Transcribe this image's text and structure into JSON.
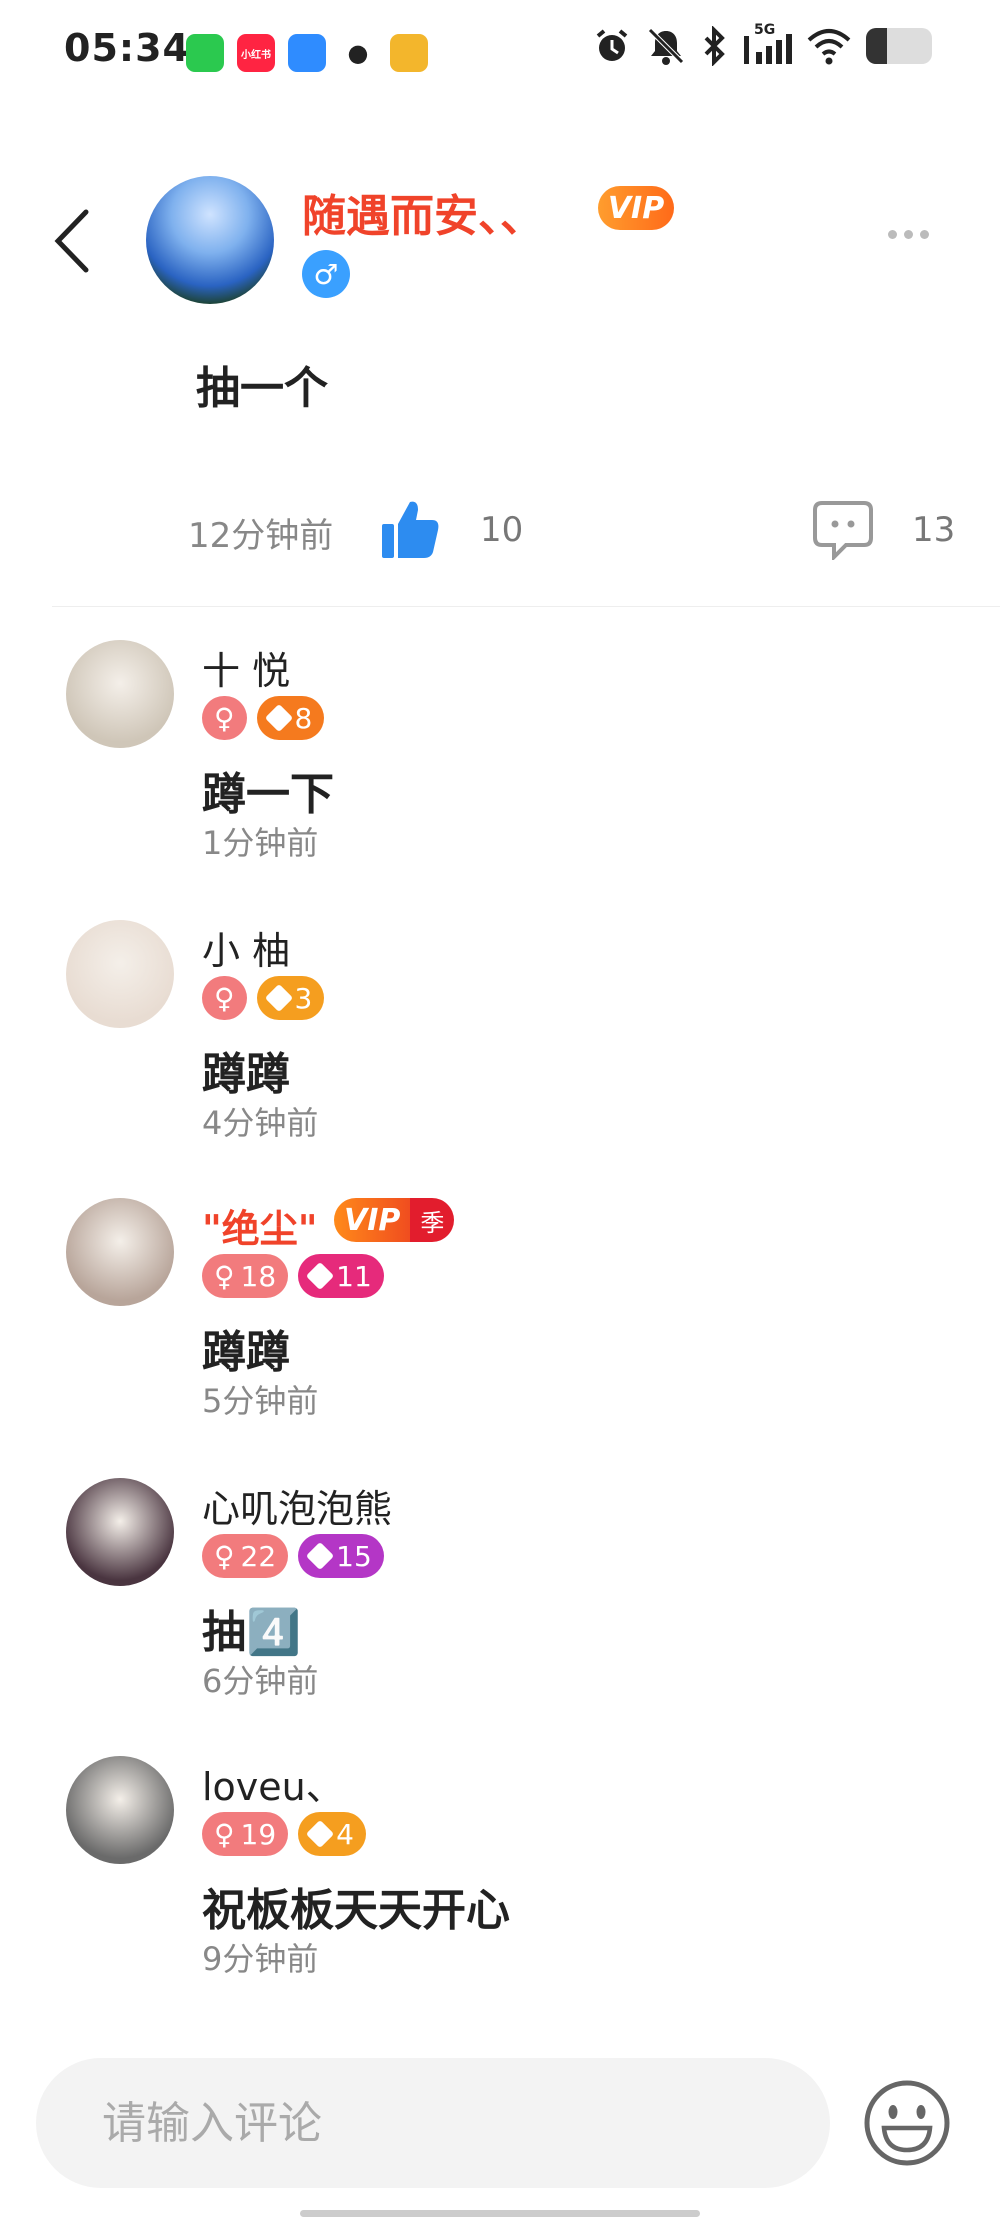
{
  "status_bar": {
    "time": "05:34",
    "apps": [
      {
        "name": "wechat-icon",
        "label": "",
        "color": "#2bc94f"
      },
      {
        "name": "xiaohongshu-icon",
        "label": "小红书",
        "color": "#ff2442"
      },
      {
        "name": "app-blue-icon",
        "label": "",
        "color": "#2f8cff"
      },
      {
        "name": "qq-icon",
        "label": "",
        "color": "#ffffff"
      },
      {
        "name": "app-orange-icon",
        "label": "",
        "color": "#f3b62c"
      }
    ],
    "network": "5G",
    "battery_level": 0.32
  },
  "post": {
    "username": "随遇而安、、",
    "vip_label": "VIP",
    "gender_symbol": "♂",
    "content": "抽一个",
    "time": "12分钟前",
    "likes": "10",
    "comments": "13"
  },
  "comments": [
    {
      "name": "十 悦",
      "vip": false,
      "gender": "♀",
      "gender_level": "",
      "level": "8",
      "level_color": "orange",
      "text": "蹲一下",
      "time": "1分钟前",
      "avatar_color": "#cfc6b8"
    },
    {
      "name": "小 柚",
      "vip": false,
      "gender": "♀",
      "gender_level": "",
      "level": "3",
      "level_color": "",
      "text": "蹲蹲",
      "time": "4分钟前",
      "avatar_color": "#e8dcd2"
    },
    {
      "name": "\"绝尘\"",
      "vip": true,
      "vip_label": "VIP",
      "vip_season": "季",
      "gender": "♀",
      "gender_level": "18",
      "level": "11",
      "level_color": "pink",
      "text": "蹲蹲",
      "time": "5分钟前",
      "avatar_color": "#b8a59a"
    },
    {
      "name": "心叽泡泡熊",
      "vip": false,
      "gender": "♀",
      "gender_level": "22",
      "level": "15",
      "level_color": "purple",
      "text": "抽4️⃣",
      "time": "6分钟前",
      "avatar_color": "#4a3540"
    },
    {
      "name": "loveu、",
      "vip": false,
      "gender": "♀",
      "gender_level": "19",
      "level": "4",
      "level_color": "",
      "text": "祝板板天天开心",
      "time": "9分钟前",
      "avatar_color": "#6a6a6a"
    }
  ],
  "input": {
    "placeholder": "请输入评论"
  }
}
